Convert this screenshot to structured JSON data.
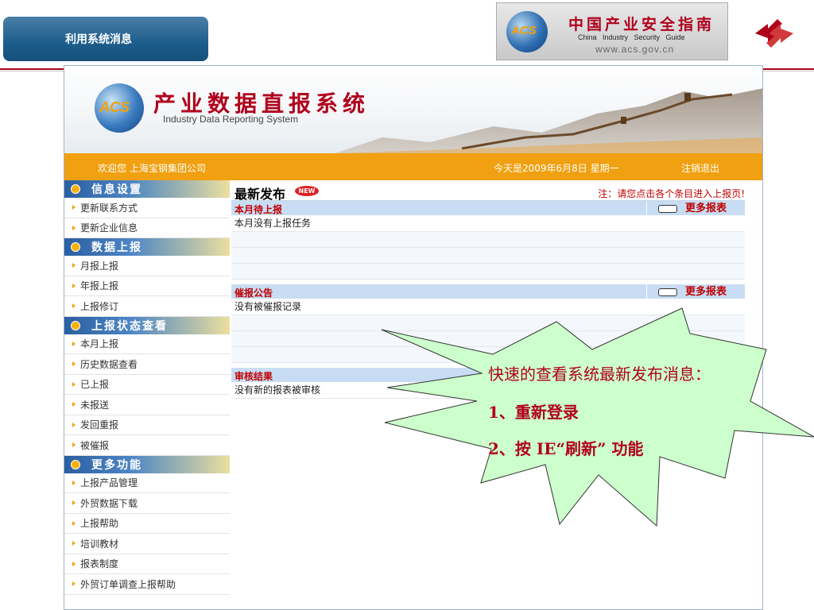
{
  "slide": {
    "tab_title": "利用系统消息"
  },
  "guide_banner": {
    "logo_text": "ACS",
    "title_cn": "中国产业安全指南",
    "title_en": "China Industry Security Guide",
    "url": "www.acs.gov.cn"
  },
  "app": {
    "logo_text": "ACS",
    "title": "产业数据直报系统",
    "subtitle": "Industry Data Reporting System",
    "welcome": "欢迎您  上海宝钢集团公司",
    "date": "今天是2009年6月8日   星期一",
    "logout": "注销退出"
  },
  "sidebar": {
    "sections": [
      {
        "title": "信息设置",
        "items": [
          "更新联系方式",
          "更新企业信息"
        ]
      },
      {
        "title": "数据上报",
        "items": [
          "月报上报",
          "年报上报",
          "上报修订"
        ]
      },
      {
        "title": "上报状态查看",
        "items": [
          "本月上报",
          "历史数据查看",
          "已上报",
          "未报送",
          "发回重报",
          "被催报"
        ]
      },
      {
        "title": "更多功能",
        "items": [
          "上报产品管理",
          "外贸数据下载",
          "上报帮助",
          "培训教材",
          "报表制度",
          "外贸订单调查上报帮助"
        ]
      }
    ]
  },
  "main": {
    "heading": "最新发布",
    "new_badge": "NEW",
    "note": "注：请您点击各个条目进入上报页!",
    "more_label": "更多报表",
    "monthly": {
      "title": "本月待上报",
      "message": "本月没有上报任务"
    },
    "urge": {
      "title": "催报公告",
      "message": "没有被催报记录"
    },
    "review": {
      "title": "审核结果",
      "message": "没有新的报表被审核"
    }
  },
  "callout": {
    "line1": "快速的查看系统最新发布消息：",
    "line2": "1、重新登录",
    "line3": "2、按 IE“刷新” 功能",
    "fill_color": "#ccffcc",
    "text_color": "#b0001c"
  }
}
